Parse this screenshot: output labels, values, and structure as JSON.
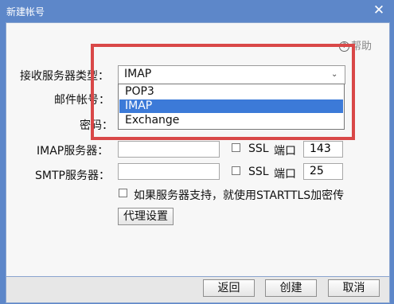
{
  "window": {
    "title": "新建帐号",
    "close_icon": "close-icon"
  },
  "help": {
    "label": "帮助"
  },
  "form": {
    "receive_server_type_label": "接收服务器类型：",
    "receive_server_type_value": "IMAP",
    "options": [
      "POP3",
      "IMAP",
      "Exchange"
    ],
    "selected_option": "IMAP",
    "email_label": "邮件帐号：",
    "password_label": "密码：",
    "imap_label": "IMAP服务器：",
    "imap_ssl_label": "SSL",
    "imap_port_label": "端口",
    "imap_port_value": "143",
    "smtp_label": "SMTP服务器：",
    "smtp_ssl_label": "SSL",
    "smtp_port_label": "端口",
    "smtp_port_value": "25",
    "starttls_label": "如果服务器支持，就使用STARTTLS加密传",
    "proxy_button": "代理设置"
  },
  "footer": {
    "back": "返回",
    "create": "创建",
    "cancel": "取消"
  }
}
